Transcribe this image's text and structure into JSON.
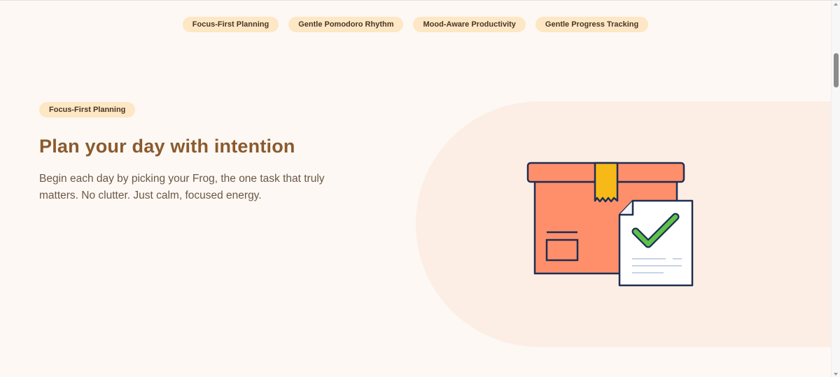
{
  "tabs": [
    {
      "label": "Focus-First Planning"
    },
    {
      "label": "Gentle Pomodoro Rhythm"
    },
    {
      "label": "Mood-Aware Productivity"
    },
    {
      "label": "Gentle Progress Tracking"
    }
  ],
  "hero": {
    "badge": "Focus-First Planning",
    "title": "Plan your day with intention",
    "description": "Begin each day by picking your Frog, the one task that truly matters. No clutter. Just calm, focused energy.",
    "illustration_icon": "package-checklist-icon"
  },
  "colors": {
    "background": "#fdf8f3",
    "pill": "#fde7c4",
    "title": "#8a5a2e",
    "blob": "#fdeee5",
    "box": "#ff8f6b",
    "check": "#5ec24a"
  }
}
